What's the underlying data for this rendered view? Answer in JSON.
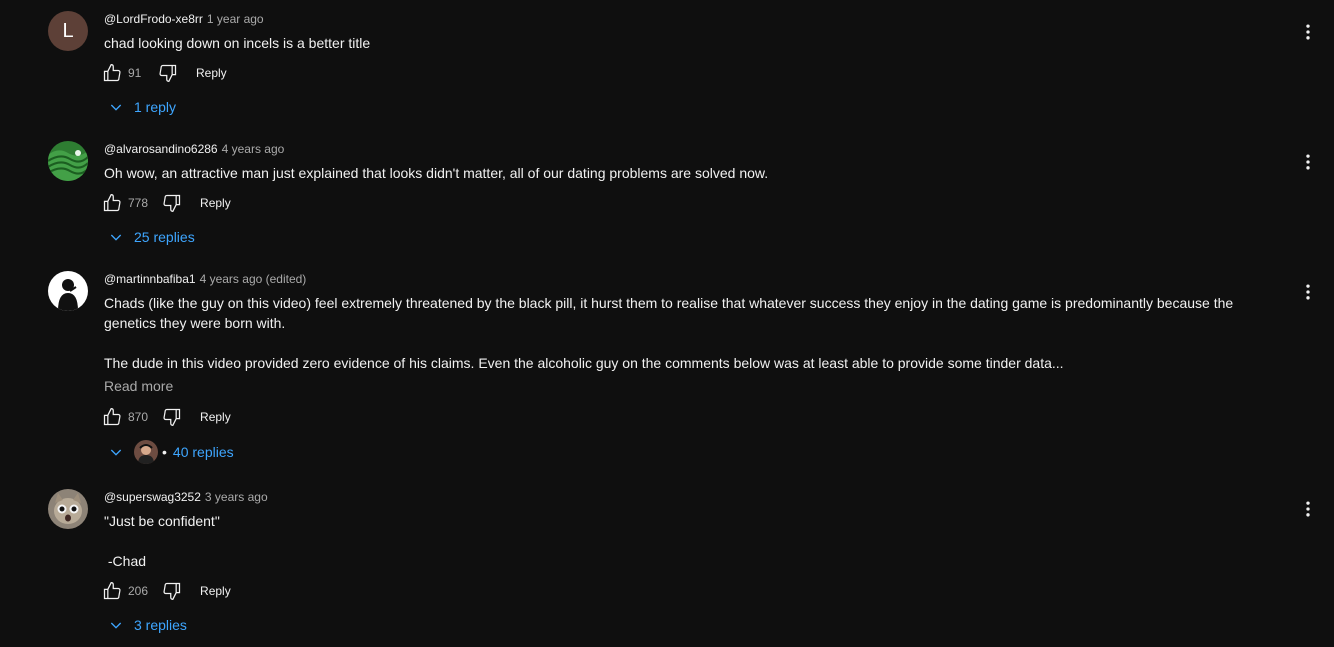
{
  "comments": [
    {
      "author": "@LordFrodo-xe8rr",
      "time": "1 year ago",
      "avatar_letter": "L",
      "text": [
        "chad looking down on incels is a better title"
      ],
      "likes": "91",
      "reply_label": "Reply",
      "replies_label": "1 reply"
    },
    {
      "author": "@alvarosandino6286",
      "time": "4 years ago",
      "text": [
        "Oh wow, an attractive man just explained that looks didn't matter, all of our dating problems are solved now."
      ],
      "likes": "778",
      "reply_label": "Reply",
      "replies_label": "25 replies"
    },
    {
      "author": "@martinnbafiba1",
      "time": "4 years ago (edited)",
      "text": [
        "Chads (like the guy on this video) feel extremely threatened by the black pill, it hurst them to realise that whatever success they enjoy in the dating game is predominantly because the genetics they were born with.",
        "",
        "The dude in this video provided zero evidence of his claims. Even the alcoholic guy on the comments below was at least able to provide some tinder data..."
      ],
      "read_more": "Read more",
      "likes": "870",
      "reply_label": "Reply",
      "replies_label": "40 replies"
    },
    {
      "author": "@superswag3252",
      "time": "3 years ago",
      "text": [
        "\"Just be confident\"",
        "",
        " -Chad"
      ],
      "likes": "206",
      "reply_label": "Reply",
      "replies_label": "3 replies"
    }
  ]
}
